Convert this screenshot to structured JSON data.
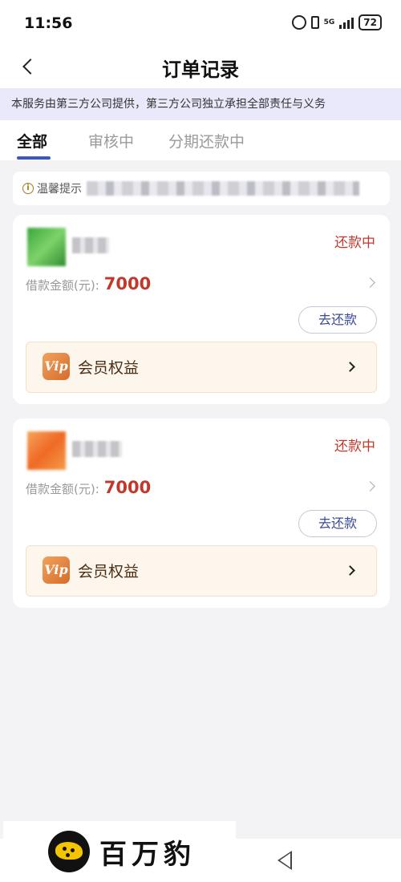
{
  "status_bar": {
    "time": "11:56",
    "network": "5G",
    "battery": "72"
  },
  "header": {
    "title": "订单记录"
  },
  "notice": "本服务由第三方公司提供，第三方公司独立承担全部责任与义务",
  "tabs": [
    {
      "label": "全部",
      "active": true
    },
    {
      "label": "审核中",
      "active": false
    },
    {
      "label": "分期还款中",
      "active": false
    }
  ],
  "tip": {
    "icon": "info-icon",
    "title": "温馨提示"
  },
  "orders": [
    {
      "status": "还款中",
      "amount_label": "借款金额(元):",
      "amount": "7000",
      "repay_label": "去还款",
      "vip": {
        "icon_text": "Vip",
        "label": "会员权益"
      }
    },
    {
      "status": "还款中",
      "amount_label": "借款金额(元):",
      "amount": "7000",
      "repay_label": "去还款",
      "vip": {
        "icon_text": "Vip",
        "label": "会员权益"
      }
    }
  ],
  "watermark": {
    "brand": "百万豹"
  },
  "colors": {
    "accent": "#3a56c9",
    "status_red": "#c0392b",
    "notice_bg": "#e9e9fb",
    "vip_bg": "#fdf6ec"
  }
}
